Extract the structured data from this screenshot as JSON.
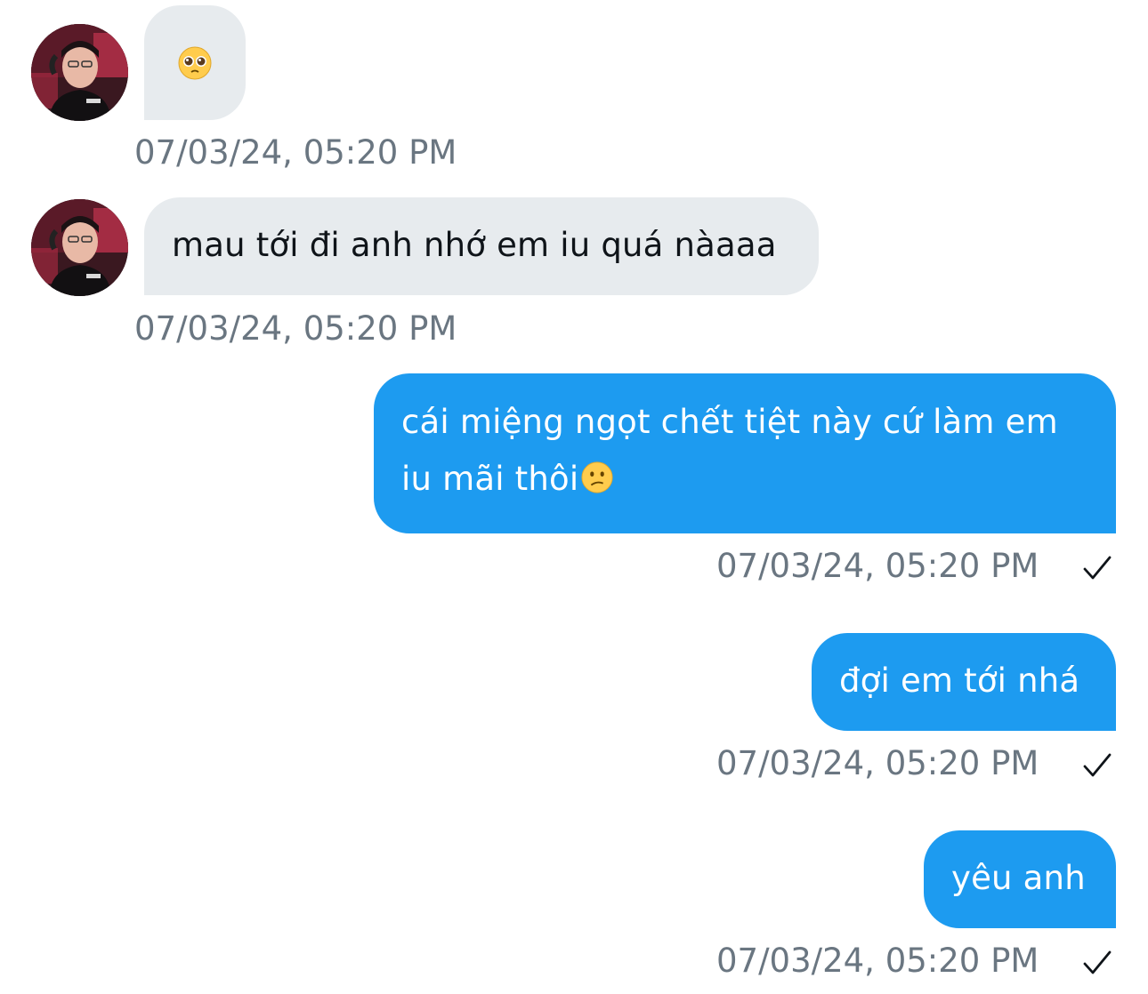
{
  "messages": [
    {
      "direction": "incoming",
      "text": "🥺",
      "timestamp": "07/03/24, 05:20 PM"
    },
    {
      "direction": "incoming",
      "text": "mau tới đi anh nhớ em iu quá nàaaa",
      "timestamp": "07/03/24, 05:20 PM"
    },
    {
      "direction": "outgoing",
      "text_line1": "cái miệng ngọt chết tiệt này cứ làm em",
      "text_line2": "iu mãi thôi",
      "emoji": "😕",
      "timestamp": "07/03/24, 05:20 PM",
      "status_icon": "checkmark-icon"
    },
    {
      "direction": "outgoing",
      "text": "đợi em tới nhá",
      "timestamp": "07/03/24, 05:20 PM",
      "status_icon": "checkmark-icon"
    },
    {
      "direction": "outgoing",
      "text": "yêu anh",
      "timestamp": "07/03/24, 05:20 PM",
      "status_icon": "checkmark-icon"
    }
  ],
  "colors": {
    "incoming_bubble": "#e7ebee",
    "outgoing_bubble": "#1d9bf0",
    "timestamp": "#6a7681",
    "background": "#ffffff"
  }
}
